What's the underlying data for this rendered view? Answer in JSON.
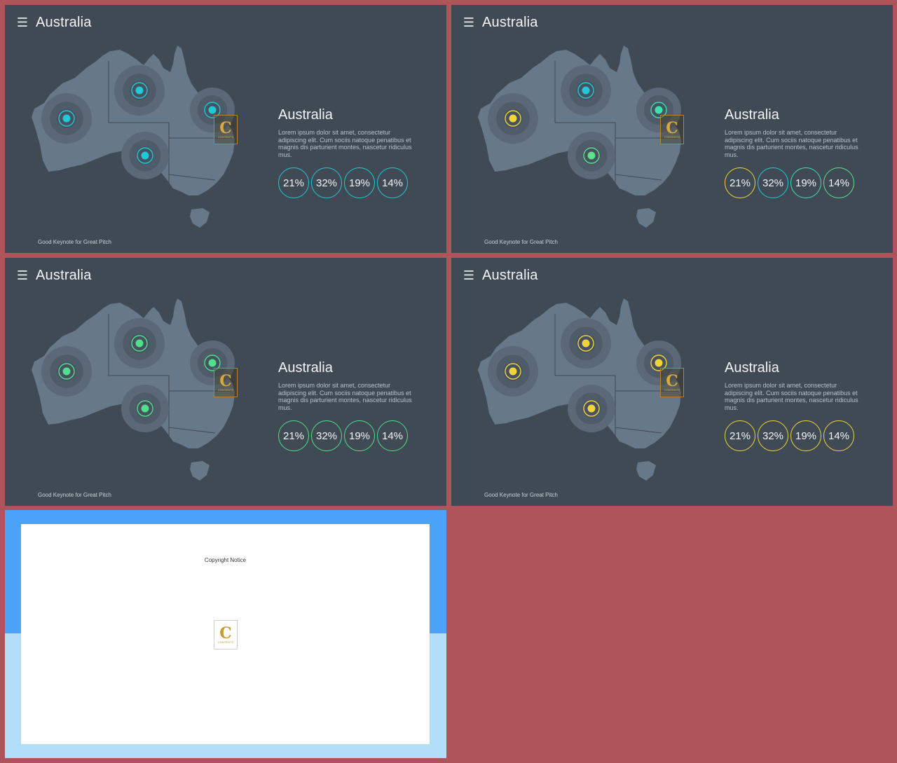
{
  "slides": [
    {
      "title": "Australia",
      "content_title": "Australia",
      "body": "Lorem ipsum dolor sit amet, consectetur adipiscing elit. Cum sociis natoque penatibus et magnis dis parturient montes, nascetur ridiculus mus.",
      "stats": [
        {
          "label": "21%",
          "color": "#22c8d8"
        },
        {
          "label": "32%",
          "color": "#22c8d8"
        },
        {
          "label": "19%",
          "color": "#22c8d8"
        },
        {
          "label": "14%",
          "color": "#22c8d8"
        }
      ],
      "markers": [
        "#22c8d8",
        "#22c8d8",
        "#22c8d8",
        "#22c8d8"
      ],
      "footer": "Good Keynote for Great Pitch",
      "badge_letter": "C",
      "badge_text": "CONTENTS"
    },
    {
      "title": "Australia",
      "content_title": "Australia",
      "body": "Lorem ipsum dolor sit amet, consectetur adipiscing elit. Cum sociis natoque penatibus et magnis dis parturient montes, nascetur ridiculus mus.",
      "stats": [
        {
          "label": "21%",
          "color": "#f2d43a"
        },
        {
          "label": "32%",
          "color": "#22c8d8"
        },
        {
          "label": "19%",
          "color": "#3fe0b0"
        },
        {
          "label": "14%",
          "color": "#5fe08a"
        }
      ],
      "markers": [
        "#f2d43a",
        "#22c8d8",
        "#3fe0b0",
        "#5fe08a"
      ],
      "footer": "Good Keynote for Great Pitch",
      "badge_letter": "C",
      "badge_text": "CONTENTS"
    },
    {
      "title": "Australia",
      "content_title": "Australia",
      "body": "Lorem ipsum dolor sit amet, consectetur adipiscing elit. Cum sociis natoque penatibus et magnis dis parturient montes, nascetur ridiculus mus.",
      "stats": [
        {
          "label": "21%",
          "color": "#4fe08a"
        },
        {
          "label": "32%",
          "color": "#4fe08a"
        },
        {
          "label": "19%",
          "color": "#4fe08a"
        },
        {
          "label": "14%",
          "color": "#4fe08a"
        }
      ],
      "markers": [
        "#4fe08a",
        "#4fe08a",
        "#4fe08a",
        "#4fe08a"
      ],
      "footer": "Good Keynote for Great Pitch",
      "badge_letter": "C",
      "badge_text": "CONTENTS"
    },
    {
      "title": "Australia",
      "content_title": "Australia",
      "body": "Lorem ipsum dolor sit amet, consectetur adipiscing elit. Cum sociis natoque penatibus et magnis dis parturient montes, nascetur ridiculus mus.",
      "stats": [
        {
          "label": "21%",
          "color": "#f2d43a"
        },
        {
          "label": "32%",
          "color": "#f2d43a"
        },
        {
          "label": "19%",
          "color": "#f2d43a"
        },
        {
          "label": "14%",
          "color": "#f2d43a"
        }
      ],
      "markers": [
        "#f2d43a",
        "#f2d43a",
        "#f2d43a",
        "#f2d43a"
      ],
      "footer": "Good Keynote for Great Pitch",
      "badge_letter": "C",
      "badge_text": "CONTENTS"
    }
  ],
  "copyright": {
    "title": "Copyright Notice",
    "logo_letter": "C",
    "logo_text": "CONTENTS"
  },
  "colors": {
    "background": "#b0545c",
    "slide": "#3f4a55",
    "map": "#677889",
    "copyright_top": "#4aa3f8",
    "copyright_bottom": "#b3defa"
  }
}
